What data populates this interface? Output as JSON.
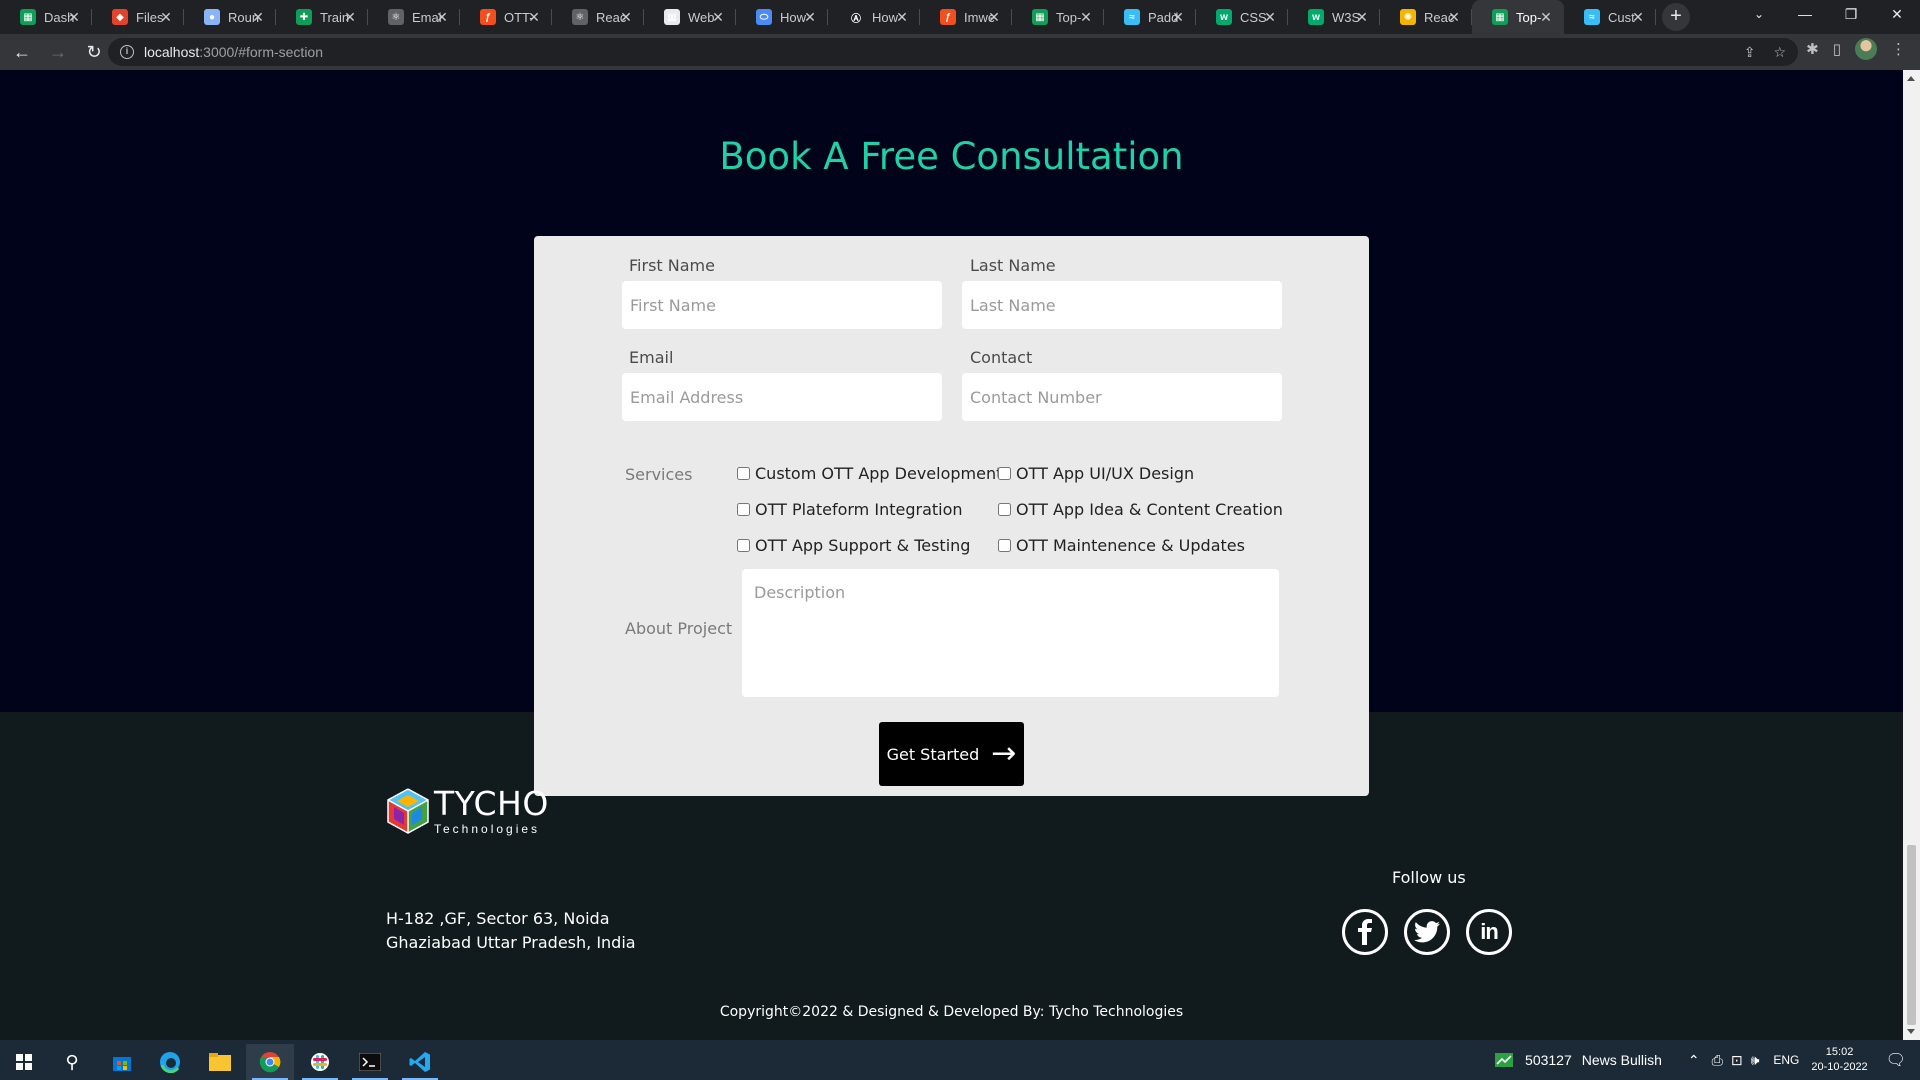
{
  "browser": {
    "tabs": [
      {
        "title": "Dash",
        "color": "#0f9d58",
        "glyph": "▦"
      },
      {
        "title": "Files",
        "color": "#e2432a",
        "glyph": "◆"
      },
      {
        "title": "Roun",
        "color": "#8ab4f8",
        "glyph": "●"
      },
      {
        "title": "Train",
        "color": "#0f9d58",
        "glyph": "✚"
      },
      {
        "title": "Emai",
        "color": "#5f6368",
        "glyph": "⚛"
      },
      {
        "title": "OTT-",
        "color": "#f24e1e",
        "glyph": "ƒ"
      },
      {
        "title": "Reac",
        "color": "#5f6368",
        "glyph": "⚛"
      },
      {
        "title": "Web",
        "color": "#e8eaed",
        "glyph": "▦"
      },
      {
        "title": "How",
        "color": "#4a8bf5",
        "glyph": "⬭"
      },
      {
        "title": "How",
        "color": "#202124",
        "glyph": "Ⓐ"
      },
      {
        "title": "Imwe",
        "color": "#f24e1e",
        "glyph": "ƒ"
      },
      {
        "title": "Top-",
        "color": "#0f9d58",
        "glyph": "▦"
      },
      {
        "title": "Padd",
        "color": "#38bdf8",
        "glyph": "≈"
      },
      {
        "title": "CSS",
        "color": "#04aa6d",
        "glyph": "w"
      },
      {
        "title": "W3S",
        "color": "#04aa6d",
        "glyph": "w"
      },
      {
        "title": "Reac",
        "color": "#f4b400",
        "glyph": "✺"
      },
      {
        "title": "Top-",
        "color": "#0f9d58",
        "glyph": "▦",
        "active": true
      },
      {
        "title": "Cust",
        "color": "#38bdf8",
        "glyph": "≈"
      }
    ],
    "url_host": "localhost",
    "url_rest": ":3000/#form-section"
  },
  "page": {
    "title": "Book A Free Consultation",
    "form": {
      "first_name": {
        "label": "First Name",
        "placeholder": "First Name"
      },
      "last_name": {
        "label": "Last Name",
        "placeholder": "Last Name"
      },
      "email": {
        "label": "Email",
        "placeholder": "Email Address"
      },
      "contact": {
        "label": "Contact",
        "placeholder": "Contact Number"
      },
      "services_label": "Services",
      "services": [
        "Custom OTT App Development",
        "OTT App UI/UX Design",
        "OTT Plateform Integration",
        "OTT App Idea & Content Creation",
        "OTT App Support & Testing",
        "OTT Maintenence & Updates"
      ],
      "about_label": "About Project",
      "description_placeholder": "Description",
      "submit_label": "Get Started"
    }
  },
  "footer": {
    "logo_name": "TYCHO",
    "logo_sub": "Technologies",
    "address_line1": "H-182 ,GF, Sector 63, Noida",
    "address_line2": "Ghaziabad Uttar Pradesh, India",
    "follow_label": "Follow us",
    "socials": [
      "facebook",
      "twitter",
      "linkedin"
    ],
    "copyright": "Copyright©2022 & Designed & Developed By: Tycho Technologies"
  },
  "taskbar": {
    "stock_value": "503127",
    "stock_text": "News Bullish",
    "language": "ENG",
    "time": "15:02",
    "date": "20-10-2022"
  }
}
